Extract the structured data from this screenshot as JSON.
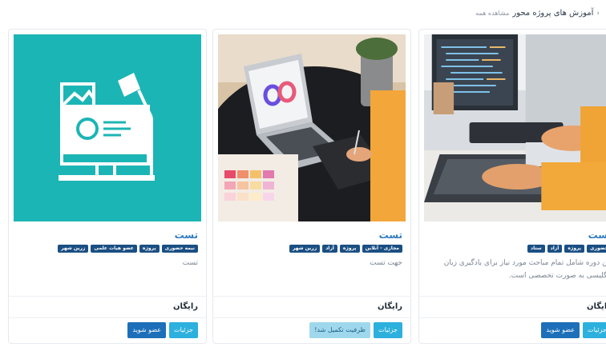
{
  "breadcrumb": {
    "arrow": "‹",
    "title": "آموزش های پروژه محور",
    "view_all": "مشاهده همه"
  },
  "cards": [
    {
      "title": "تست",
      "tags": [
        "حضوری",
        "پروژه",
        "آزاد",
        "ستاد"
      ],
      "description": "این دوره شامل تمام مباحث مورد نیاز برای یادگیری زبان انگلیسی به صورت تخصصی است.",
      "price": "رایگان",
      "buttons": {
        "details": "جزئیات",
        "action": "عضو شوید"
      },
      "image": "programmer-at-desk"
    },
    {
      "title": "تست",
      "tags": [
        "مجازی - آنلاین",
        "پروژه",
        "آزاد",
        "زرین شهر"
      ],
      "description": "جهت تست",
      "price": "رایگان",
      "buttons": {
        "details": "جزئیات",
        "action": "ظرفیت تکمیل شد!"
      },
      "image": "laptop-design-workspace"
    },
    {
      "title": "تست",
      "tags": [
        "نیمه حضوری",
        "پروژه",
        "عضو هیات علمی",
        "زرین شهر"
      ],
      "description": "تست",
      "price": "رایگان",
      "buttons": {
        "details": "جزئیات",
        "action": "عضو شوید"
      },
      "image": "computer-illustration"
    }
  ],
  "colors": {
    "link_blue": "#2f7bbf",
    "tag_navy": "#1a4f83",
    "details_button": "#2cb0dd",
    "join_button": "#1c6fb8",
    "full_button": "#9fd8ec",
    "illustration_teal": "#1cb5b5"
  }
}
